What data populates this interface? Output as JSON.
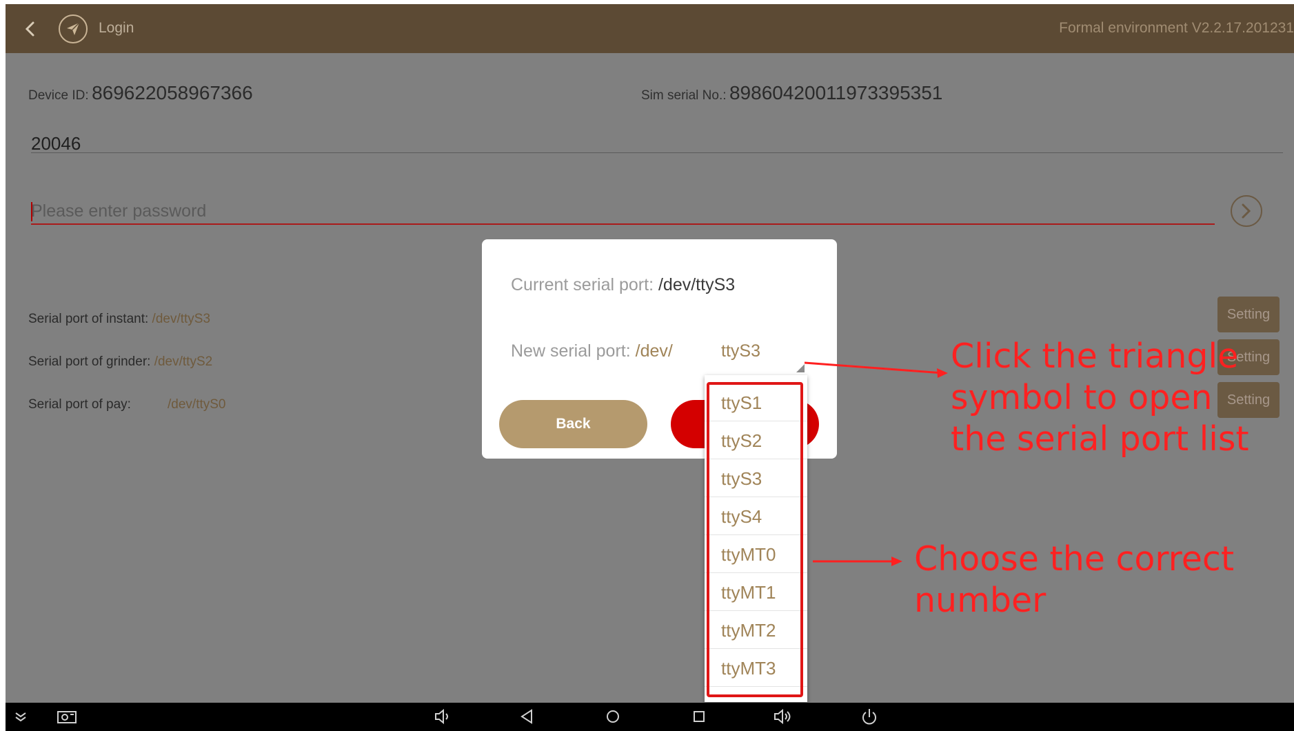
{
  "header": {
    "title": "Login",
    "version": "Formal environment V2.2.17.201231"
  },
  "device": {
    "device_id_label": "Device ID:",
    "device_id_value": "869622058967366",
    "sim_label": "Sim serial No.:",
    "sim_value": "89860420011973395351"
  },
  "login": {
    "account": "20046",
    "password_placeholder": "Please enter password"
  },
  "ports": [
    {
      "label": "Serial port of instant:",
      "value": "/dev/ttyS3",
      "button": "Setting"
    },
    {
      "label": "Serial port of grinder:",
      "value": "/dev/ttyS2",
      "button": "Setting"
    },
    {
      "label": "Serial port of pay:",
      "value": "/dev/ttyS0",
      "button": "Setting"
    }
  ],
  "dialog": {
    "current_label": "Current serial port:",
    "current_value": "/dev/ttyS3",
    "new_label": "New serial port:",
    "new_prefix": "/dev/",
    "selected": "ttyS3",
    "back_label": "Back"
  },
  "dropdown_options": [
    "ttyS1",
    "ttyS2",
    "ttyS3",
    "ttyS4",
    "ttyMT0",
    "ttyMT1",
    "ttyMT2",
    "ttyMT3"
  ],
  "annotations": {
    "triangle_hint": "Click the triangle symbol to open the serial port list",
    "choose_hint": "Choose the correct number"
  },
  "colors": {
    "header_bg": "#5c4a34",
    "accent_gold": "#a08458",
    "confirm_red": "#d40000",
    "annotation_red": "#ff2020"
  },
  "icons": {
    "header": [
      "back-chevron-icon",
      "paper-plane-icon"
    ],
    "login": [
      "arrow-right-circle-icon"
    ],
    "navbar": [
      "collapse-icon",
      "screenshot-icon",
      "volume-down-icon",
      "back-icon",
      "home-icon",
      "recents-icon",
      "volume-up-icon",
      "power-icon"
    ]
  }
}
